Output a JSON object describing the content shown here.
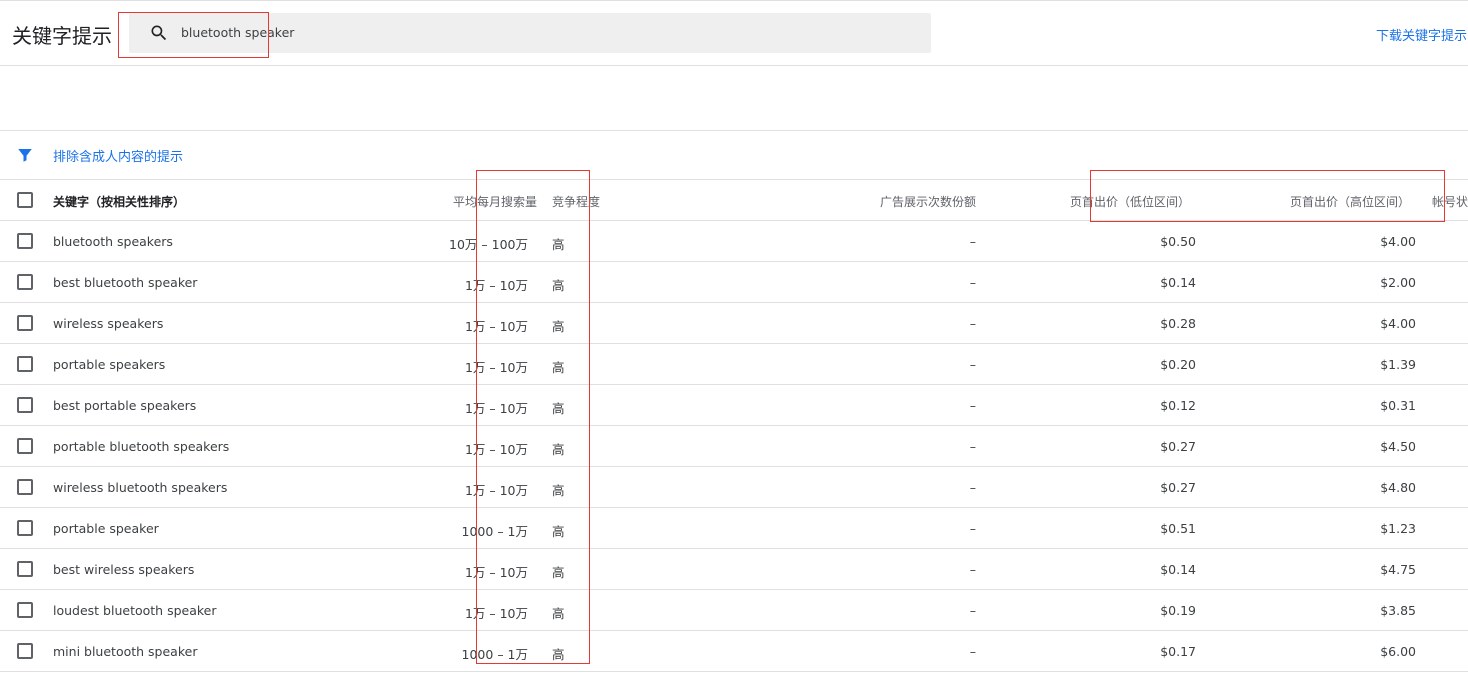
{
  "header": {
    "title": "关键字提示",
    "search_value": "bluetooth speaker",
    "download_label": "下载关键字提示"
  },
  "filter": {
    "label": "排除含成人内容的提示"
  },
  "table": {
    "columns": {
      "keyword": "关键字（按相关性排序）",
      "avg_monthly": "平均每月搜索量",
      "competition": "竞争程度",
      "impression_share": "广告展示次数份额",
      "bid_low": "页首出价（低位区间）",
      "bid_high": "页首出价（高位区间）",
      "account_status": "帐号状"
    },
    "rows": [
      {
        "keyword": "bluetooth speakers",
        "avg_monthly": "10万 – 100万",
        "competition": "高",
        "impression_share": "–",
        "bid_low": "$0.50",
        "bid_high": "$4.00"
      },
      {
        "keyword": "best bluetooth speaker",
        "avg_monthly": "1万 – 10万",
        "competition": "高",
        "impression_share": "–",
        "bid_low": "$0.14",
        "bid_high": "$2.00"
      },
      {
        "keyword": "wireless speakers",
        "avg_monthly": "1万 – 10万",
        "competition": "高",
        "impression_share": "–",
        "bid_low": "$0.28",
        "bid_high": "$4.00"
      },
      {
        "keyword": "portable speakers",
        "avg_monthly": "1万 – 10万",
        "competition": "高",
        "impression_share": "–",
        "bid_low": "$0.20",
        "bid_high": "$1.39"
      },
      {
        "keyword": "best portable speakers",
        "avg_monthly": "1万 – 10万",
        "competition": "高",
        "impression_share": "–",
        "bid_low": "$0.12",
        "bid_high": "$0.31"
      },
      {
        "keyword": "portable bluetooth speakers",
        "avg_monthly": "1万 – 10万",
        "competition": "高",
        "impression_share": "–",
        "bid_low": "$0.27",
        "bid_high": "$4.50"
      },
      {
        "keyword": "wireless bluetooth speakers",
        "avg_monthly": "1万 – 10万",
        "competition": "高",
        "impression_share": "–",
        "bid_low": "$0.27",
        "bid_high": "$4.80"
      },
      {
        "keyword": "portable speaker",
        "avg_monthly": "1000 – 1万",
        "competition": "高",
        "impression_share": "–",
        "bid_low": "$0.51",
        "bid_high": "$1.23"
      },
      {
        "keyword": "best wireless speakers",
        "avg_monthly": "1万 – 10万",
        "competition": "高",
        "impression_share": "–",
        "bid_low": "$0.14",
        "bid_high": "$4.75"
      },
      {
        "keyword": "loudest bluetooth speaker",
        "avg_monthly": "1万 – 10万",
        "competition": "高",
        "impression_share": "–",
        "bid_low": "$0.19",
        "bid_high": "$3.85"
      },
      {
        "keyword": "mini bluetooth speaker",
        "avg_monthly": "1000 – 1万",
        "competition": "高",
        "impression_share": "–",
        "bid_low": "$0.17",
        "bid_high": "$6.00"
      }
    ]
  },
  "colors": {
    "link": "#1a73e8",
    "annotation_red": "#e53935",
    "divider": "#e0e0e0"
  }
}
